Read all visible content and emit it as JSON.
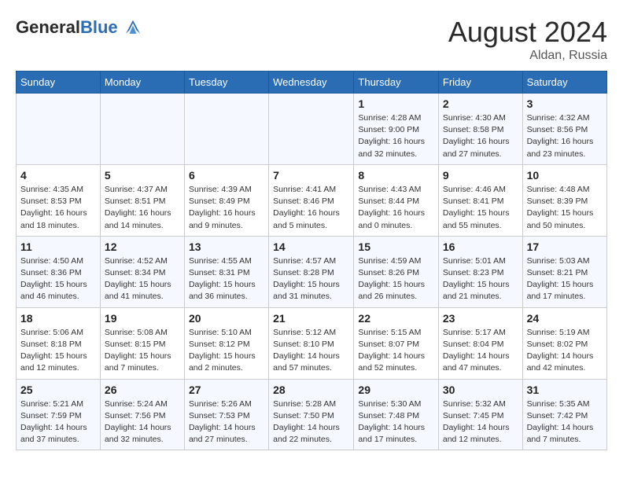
{
  "header": {
    "logo_line1": "General",
    "logo_line2": "Blue",
    "month_year": "August 2024",
    "location": "Aldan, Russia"
  },
  "weekdays": [
    "Sunday",
    "Monday",
    "Tuesday",
    "Wednesday",
    "Thursday",
    "Friday",
    "Saturday"
  ],
  "weeks": [
    [
      {
        "day": "",
        "info": ""
      },
      {
        "day": "",
        "info": ""
      },
      {
        "day": "",
        "info": ""
      },
      {
        "day": "",
        "info": ""
      },
      {
        "day": "1",
        "info": "Sunrise: 4:28 AM\nSunset: 9:00 PM\nDaylight: 16 hours and 32 minutes."
      },
      {
        "day": "2",
        "info": "Sunrise: 4:30 AM\nSunset: 8:58 PM\nDaylight: 16 hours and 27 minutes."
      },
      {
        "day": "3",
        "info": "Sunrise: 4:32 AM\nSunset: 8:56 PM\nDaylight: 16 hours and 23 minutes."
      }
    ],
    [
      {
        "day": "4",
        "info": "Sunrise: 4:35 AM\nSunset: 8:53 PM\nDaylight: 16 hours and 18 minutes."
      },
      {
        "day": "5",
        "info": "Sunrise: 4:37 AM\nSunset: 8:51 PM\nDaylight: 16 hours and 14 minutes."
      },
      {
        "day": "6",
        "info": "Sunrise: 4:39 AM\nSunset: 8:49 PM\nDaylight: 16 hours and 9 minutes."
      },
      {
        "day": "7",
        "info": "Sunrise: 4:41 AM\nSunset: 8:46 PM\nDaylight: 16 hours and 5 minutes."
      },
      {
        "day": "8",
        "info": "Sunrise: 4:43 AM\nSunset: 8:44 PM\nDaylight: 16 hours and 0 minutes."
      },
      {
        "day": "9",
        "info": "Sunrise: 4:46 AM\nSunset: 8:41 PM\nDaylight: 15 hours and 55 minutes."
      },
      {
        "day": "10",
        "info": "Sunrise: 4:48 AM\nSunset: 8:39 PM\nDaylight: 15 hours and 50 minutes."
      }
    ],
    [
      {
        "day": "11",
        "info": "Sunrise: 4:50 AM\nSunset: 8:36 PM\nDaylight: 15 hours and 46 minutes."
      },
      {
        "day": "12",
        "info": "Sunrise: 4:52 AM\nSunset: 8:34 PM\nDaylight: 15 hours and 41 minutes."
      },
      {
        "day": "13",
        "info": "Sunrise: 4:55 AM\nSunset: 8:31 PM\nDaylight: 15 hours and 36 minutes."
      },
      {
        "day": "14",
        "info": "Sunrise: 4:57 AM\nSunset: 8:28 PM\nDaylight: 15 hours and 31 minutes."
      },
      {
        "day": "15",
        "info": "Sunrise: 4:59 AM\nSunset: 8:26 PM\nDaylight: 15 hours and 26 minutes."
      },
      {
        "day": "16",
        "info": "Sunrise: 5:01 AM\nSunset: 8:23 PM\nDaylight: 15 hours and 21 minutes."
      },
      {
        "day": "17",
        "info": "Sunrise: 5:03 AM\nSunset: 8:21 PM\nDaylight: 15 hours and 17 minutes."
      }
    ],
    [
      {
        "day": "18",
        "info": "Sunrise: 5:06 AM\nSunset: 8:18 PM\nDaylight: 15 hours and 12 minutes."
      },
      {
        "day": "19",
        "info": "Sunrise: 5:08 AM\nSunset: 8:15 PM\nDaylight: 15 hours and 7 minutes."
      },
      {
        "day": "20",
        "info": "Sunrise: 5:10 AM\nSunset: 8:12 PM\nDaylight: 15 hours and 2 minutes."
      },
      {
        "day": "21",
        "info": "Sunrise: 5:12 AM\nSunset: 8:10 PM\nDaylight: 14 hours and 57 minutes."
      },
      {
        "day": "22",
        "info": "Sunrise: 5:15 AM\nSunset: 8:07 PM\nDaylight: 14 hours and 52 minutes."
      },
      {
        "day": "23",
        "info": "Sunrise: 5:17 AM\nSunset: 8:04 PM\nDaylight: 14 hours and 47 minutes."
      },
      {
        "day": "24",
        "info": "Sunrise: 5:19 AM\nSunset: 8:02 PM\nDaylight: 14 hours and 42 minutes."
      }
    ],
    [
      {
        "day": "25",
        "info": "Sunrise: 5:21 AM\nSunset: 7:59 PM\nDaylight: 14 hours and 37 minutes."
      },
      {
        "day": "26",
        "info": "Sunrise: 5:24 AM\nSunset: 7:56 PM\nDaylight: 14 hours and 32 minutes."
      },
      {
        "day": "27",
        "info": "Sunrise: 5:26 AM\nSunset: 7:53 PM\nDaylight: 14 hours and 27 minutes."
      },
      {
        "day": "28",
        "info": "Sunrise: 5:28 AM\nSunset: 7:50 PM\nDaylight: 14 hours and 22 minutes."
      },
      {
        "day": "29",
        "info": "Sunrise: 5:30 AM\nSunset: 7:48 PM\nDaylight: 14 hours and 17 minutes."
      },
      {
        "day": "30",
        "info": "Sunrise: 5:32 AM\nSunset: 7:45 PM\nDaylight: 14 hours and 12 minutes."
      },
      {
        "day": "31",
        "info": "Sunrise: 5:35 AM\nSunset: 7:42 PM\nDaylight: 14 hours and 7 minutes."
      }
    ]
  ]
}
